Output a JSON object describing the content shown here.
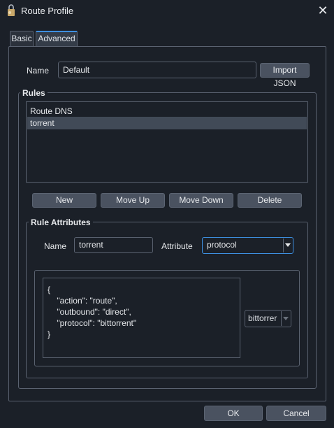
{
  "window": {
    "title": "Route Profile"
  },
  "tabs": [
    {
      "label": "Basic"
    },
    {
      "label": "Advanced"
    }
  ],
  "profile": {
    "name_label": "Name",
    "name_value": "Default",
    "import_label": "Import JSON"
  },
  "rules": {
    "title": "Rules",
    "items": [
      {
        "label": "Route DNS"
      },
      {
        "label": "torrent"
      }
    ],
    "buttons": {
      "new": "New",
      "move_up": "Move Up",
      "move_down": "Move Down",
      "delete": "Delete"
    }
  },
  "rule_attributes": {
    "title": "Rule Attributes",
    "name_label": "Name",
    "name_value": "torrent",
    "attribute_label": "Attribute",
    "attribute_value": "protocol",
    "json_text": "{\n    \"action\": \"route\",\n    \"outbound\": \"direct\",\n    \"protocol\": \"bittorrent\"\n}",
    "value_select": "bittorrer"
  },
  "footer": {
    "ok": "OK",
    "cancel": "Cancel"
  },
  "colors": {
    "background": "#1b2028",
    "accent": "#3d8fe0",
    "button": "#4a5260"
  }
}
